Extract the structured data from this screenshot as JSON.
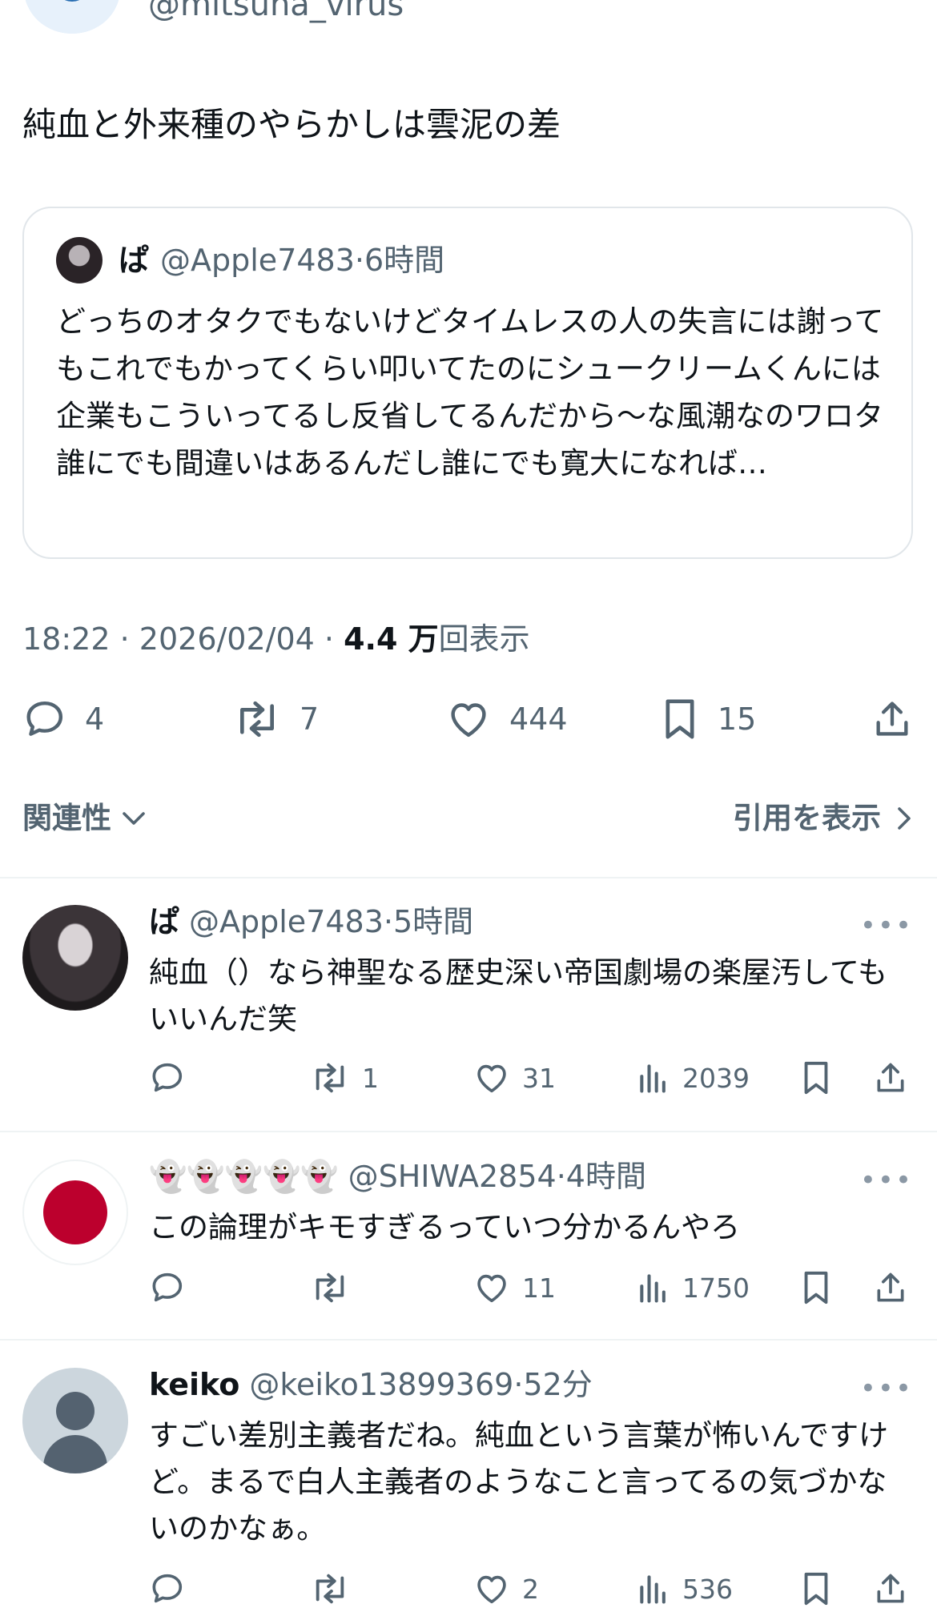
{
  "tweet": {
    "handle": "@mitsuna_virus",
    "text": "純血と外来種のやらかしは雲泥の差",
    "quote": {
      "name": "ぱ",
      "handle": "@Apple7483",
      "sep": "·",
      "time": "6時間",
      "text": "どっちのオタクでもないけどタイムレスの人の失言には謝ってもこれでもかってくらい叩いてたのにシュークリームくんには企業もこういってるし反省してるんだから〜な風潮なのワロタ\n誰にでも間違いはあるんだし誰にでも寛大になれば…"
    },
    "time": "18:22",
    "dot": "·",
    "date": "2026/02/04",
    "views_count": "4.4 万",
    "views_label": "回表示",
    "reply_count": "4",
    "retweet_count": "7",
    "like_count": "444",
    "bookmark_count": "15"
  },
  "sort": {
    "label": "関連性",
    "quotes_label": "引用を表示"
  },
  "replies": [
    {
      "name": "ぱ",
      "handle": "@Apple7483",
      "sep": "·",
      "time": "5時間",
      "text": "純血（）なら神聖なる歴史深い帝国劇場の楽屋汚してもいいんだ笑",
      "reply_count": "",
      "retweet_count": "1",
      "like_count": "31",
      "view_count": "2039"
    },
    {
      "name": "👻👻👻👻👻",
      "handle": "@SHIWA2854",
      "sep": "·",
      "time": "4時間",
      "text": "この論理がキモすぎるっていつ分かるんやろ",
      "reply_count": "",
      "retweet_count": "",
      "like_count": "11",
      "view_count": "1750"
    },
    {
      "name": "keiko",
      "handle": "@keiko13899369",
      "sep": "·",
      "time": "52分",
      "text": "すごい差別主義者だね。純血という言葉が怖いんですけど。まるで白人主義者のようなこと言ってるの気づかないのかなぁ。",
      "reply_count": "",
      "retweet_count": "",
      "like_count": "2",
      "view_count": "536"
    }
  ],
  "icons": {
    "reply": "reply-icon",
    "retweet": "retweet-icon",
    "like": "heart-icon",
    "bookmark": "bookmark-icon",
    "share": "share-icon",
    "views": "views-icon",
    "more": "more-icon",
    "chevron": "chevron-down-icon",
    "chevron_right": "chevron-right-icon"
  },
  "colors": {
    "secondary_text": "#536471",
    "border": "#e1e6ea",
    "divider": "#eff3f4",
    "flag_red": "#bc002d"
  }
}
